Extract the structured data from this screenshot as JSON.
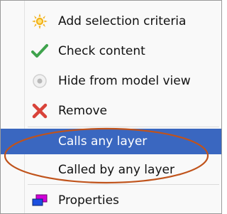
{
  "menu": {
    "items": [
      {
        "label": "Add selection criteria",
        "icon": "sun-icon"
      },
      {
        "label": "Check content",
        "icon": "checkmark-icon"
      },
      {
        "label": "Hide from model view",
        "icon": "hide-circle-icon"
      },
      {
        "label": "Remove",
        "icon": "red-x-icon"
      },
      {
        "label": "Calls any layer",
        "selected": true
      },
      {
        "label": "Called by any layer"
      },
      {
        "label": "Properties",
        "icon": "properties-icon"
      }
    ]
  },
  "colors": {
    "selection": "#3a67c0",
    "annotation_ellipse": "#c0531b",
    "check_green": "#3fa34d",
    "remove_red": "#d9433a"
  }
}
